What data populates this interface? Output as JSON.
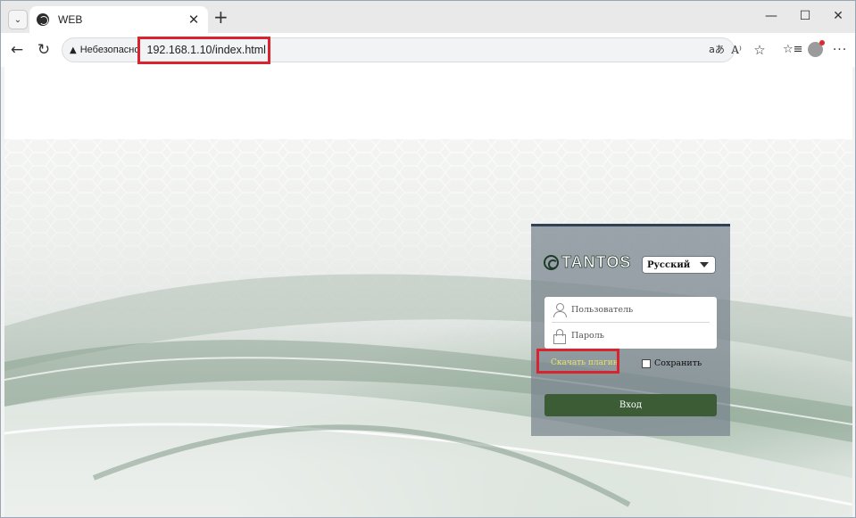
{
  "browser": {
    "tab": {
      "title": "WEB",
      "close_glyph": "✕"
    },
    "new_tab_glyph": "+",
    "tab_list_glyph": "⌄",
    "window_controls": {
      "minimize": "—",
      "maximize": "☐",
      "close": "✕"
    },
    "nav": {
      "back": "←",
      "reload": "↻"
    },
    "address_bar": {
      "security_label": "Небезопасно",
      "url": "192.168.1.10/index.html"
    },
    "toolbar": {
      "aa_glyph": "aあ",
      "read_glyph": "A⁾",
      "star_glyph": "☆",
      "fav_glyph": "☆≡",
      "more_glyph": "···"
    },
    "highlight_color": "#d9232e"
  },
  "login": {
    "brand": "TANTOS",
    "language": {
      "selected": "Русский"
    },
    "username_placeholder": "Пользователь",
    "password_placeholder": "Пароль",
    "plugin_link": "Скачать плагин",
    "remember_label": "Сохранить",
    "login_button": "Вход",
    "accent_color": "#3c5c36",
    "link_color": "#e8e26a"
  },
  "icons": {
    "favicon": "globe-icon",
    "user": "user-icon",
    "password": "lock-icon",
    "warning": "warning-icon",
    "profile": "profile-avatar-icon"
  }
}
